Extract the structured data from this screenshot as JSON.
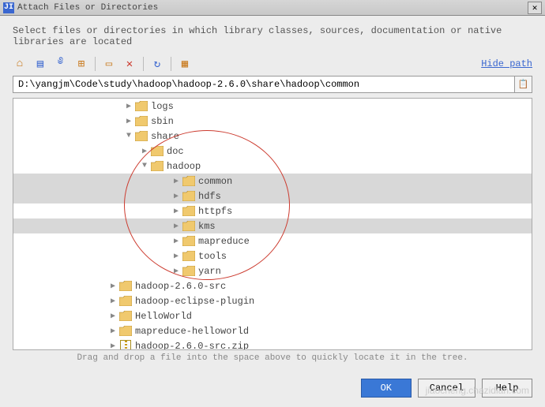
{
  "window": {
    "title": "Attach Files or Directories"
  },
  "instruction": "Select files or directories in which library classes, sources, documentation or native libraries are located",
  "hide_path": "Hide path",
  "path": "D:\\yangjm\\Code\\study\\hadoop\\hadoop-2.6.0\\share\\hadoop\\common",
  "hint": "Drag and drop a file into the space above to quickly locate it in the tree.",
  "buttons": {
    "ok": "OK",
    "cancel": "Cancel",
    "help": "Help"
  },
  "toolbar_icons": [
    "home",
    "module",
    "scroll",
    "new-folder",
    "delete",
    "remove",
    "refresh",
    "show-hidden"
  ],
  "tree": [
    {
      "indent": 140,
      "exp": "▶",
      "type": "folder",
      "label": "logs",
      "sel": false
    },
    {
      "indent": 140,
      "exp": "▶",
      "type": "folder",
      "label": "sbin",
      "sel": false
    },
    {
      "indent": 140,
      "exp": "▼",
      "type": "folder",
      "label": "share",
      "sel": false
    },
    {
      "indent": 160,
      "exp": "▶",
      "type": "folder",
      "label": "doc",
      "sel": false
    },
    {
      "indent": 160,
      "exp": "▼",
      "type": "folder",
      "label": "hadoop",
      "sel": false
    },
    {
      "indent": 200,
      "exp": "▶",
      "type": "folder",
      "label": "common",
      "sel": true
    },
    {
      "indent": 200,
      "exp": "▶",
      "type": "folder",
      "label": "hdfs",
      "sel": true
    },
    {
      "indent": 200,
      "exp": "▶",
      "type": "folder",
      "label": "httpfs",
      "sel": false
    },
    {
      "indent": 200,
      "exp": "▶",
      "type": "folder",
      "label": "kms",
      "sel": true
    },
    {
      "indent": 200,
      "exp": "▶",
      "type": "folder",
      "label": "mapreduce",
      "sel": false
    },
    {
      "indent": 200,
      "exp": "▶",
      "type": "folder",
      "label": "tools",
      "sel": false
    },
    {
      "indent": 200,
      "exp": "▶",
      "type": "folder",
      "label": "yarn",
      "sel": false
    },
    {
      "indent": 120,
      "exp": "▶",
      "type": "folder",
      "label": "hadoop-2.6.0-src",
      "sel": false
    },
    {
      "indent": 120,
      "exp": "▶",
      "type": "folder",
      "label": "hadoop-eclipse-plugin",
      "sel": false
    },
    {
      "indent": 120,
      "exp": "▶",
      "type": "folder",
      "label": "HelloWorld",
      "sel": false
    },
    {
      "indent": 120,
      "exp": "▶",
      "type": "folder",
      "label": "mapreduce-helloworld",
      "sel": false
    },
    {
      "indent": 120,
      "exp": "▶",
      "type": "zip",
      "label": "hadoop-2.6.0-src.zip",
      "sel": false
    }
  ],
  "watermark": "jiaocheng.chazidian.com"
}
